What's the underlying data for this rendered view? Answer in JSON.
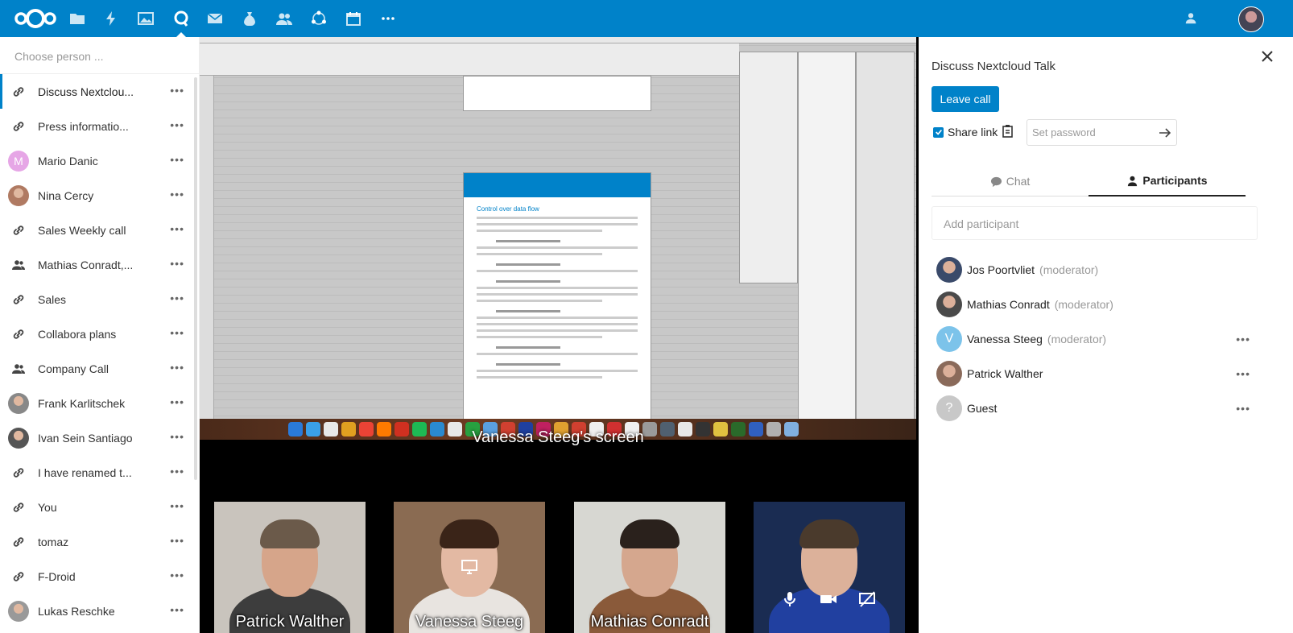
{
  "header": {
    "apps": [
      {
        "name": "files-icon"
      },
      {
        "name": "activity-icon"
      },
      {
        "name": "gallery-icon"
      },
      {
        "name": "talk-icon",
        "active": true
      },
      {
        "name": "mail-icon"
      },
      {
        "name": "money-icon"
      },
      {
        "name": "contacts-icon"
      },
      {
        "name": "circles-icon"
      },
      {
        "name": "calendar-icon"
      },
      {
        "name": "more-apps-icon"
      }
    ],
    "accent_color": "#0082c9"
  },
  "sidebar": {
    "search_placeholder": "Choose person ...",
    "more_label": "•••",
    "items": [
      {
        "label": "Discuss Nextclou...",
        "icon": "link-icon",
        "active": true
      },
      {
        "label": "Press informatio...",
        "icon": "link-icon"
      },
      {
        "label": "Mario Danic",
        "icon": "avatar-letter",
        "letter": "M",
        "color": "#e6a6e6"
      },
      {
        "label": "Nina Cercy",
        "icon": "avatar-photo",
        "color": "#b07a62"
      },
      {
        "label": "Sales Weekly call",
        "icon": "link-icon"
      },
      {
        "label": "Mathias Conradt,...",
        "icon": "group-icon"
      },
      {
        "label": "Sales",
        "icon": "link-icon"
      },
      {
        "label": "Collabora plans",
        "icon": "link-icon"
      },
      {
        "label": "Company Call",
        "icon": "group-icon"
      },
      {
        "label": "Frank Karlitschek",
        "icon": "avatar-photo",
        "color": "#888"
      },
      {
        "label": "Ivan Sein Santiago",
        "icon": "avatar-photo",
        "color": "#555"
      },
      {
        "label": "I have renamed t...",
        "icon": "link-icon"
      },
      {
        "label": "You",
        "icon": "link-icon"
      },
      {
        "label": "tomaz",
        "icon": "link-icon"
      },
      {
        "label": "F-Droid",
        "icon": "link-icon"
      },
      {
        "label": "Lukas Reschke",
        "icon": "avatar-photo",
        "color": "#999"
      }
    ]
  },
  "stage": {
    "screen_caption": "Vanessa Steeg's screen",
    "shared_doc_heading": "Control over data flow",
    "videos": [
      {
        "name": "Patrick Walther",
        "bg": "#c9c4bd",
        "skin": "#d6a58a",
        "hair": "#6b5a4a",
        "shirt": "#3d3d3d"
      },
      {
        "name": "Vanessa Steeg",
        "bg": "#8a6b52",
        "skin": "#e3b9a3",
        "hair": "#3a2418",
        "shirt": "#e8e4e0"
      },
      {
        "name": "Mathias Conradt",
        "bg": "#d7d7d2",
        "skin": "#d5a78e",
        "hair": "#2a211c",
        "shirt": "#8a5a3a"
      },
      {
        "name": "",
        "bg": "#1a2c52",
        "skin": "#dcb19a",
        "hair": "#4a3a2c",
        "shirt": "#2140a0"
      }
    ]
  },
  "panel": {
    "title": "Discuss Nextcloud Talk",
    "leave_label": "Leave call",
    "share_link_label": "Share link",
    "password_placeholder": "Set password",
    "tab_chat": "Chat",
    "tab_participants": "Participants",
    "add_participant_placeholder": "Add participant",
    "more_label": "•••",
    "participants": [
      {
        "name": "Jos Poortvliet",
        "role": "(moderator)",
        "avatar": "photo",
        "color": "#3a4a6a",
        "more": false
      },
      {
        "name": "Mathias Conradt",
        "role": "(moderator)",
        "avatar": "photo",
        "color": "#4a4a4a",
        "more": false
      },
      {
        "name": "Vanessa Steeg",
        "role": "(moderator)",
        "avatar": "letter",
        "letter": "V",
        "color": "#7cc3ea",
        "more": true
      },
      {
        "name": "Patrick Walther",
        "role": "",
        "avatar": "photo",
        "color": "#8a6a5a",
        "more": true
      },
      {
        "name": "Guest",
        "role": "",
        "avatar": "letter",
        "letter": "?",
        "color": "#c8c8c8",
        "more": true
      }
    ]
  }
}
